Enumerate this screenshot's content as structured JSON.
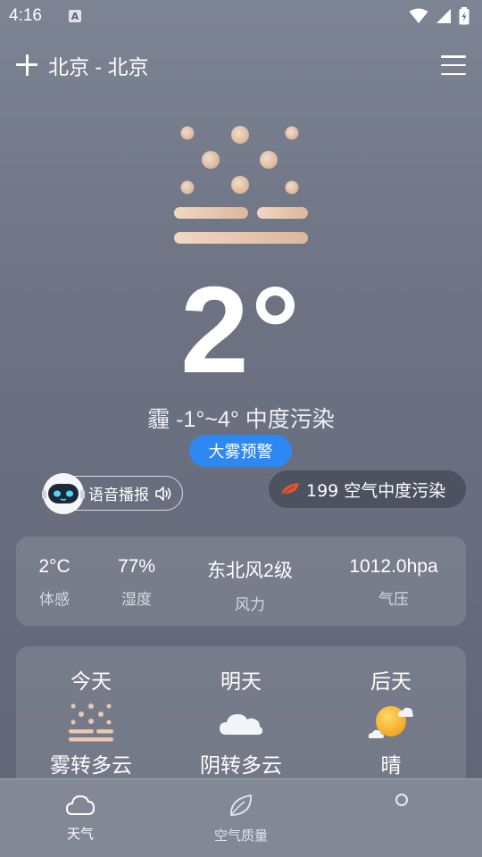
{
  "status_bar": {
    "time": "4:16",
    "notification_letter": "A",
    "icons": [
      "wifi-icon",
      "signal-icon",
      "battery-charging-icon"
    ]
  },
  "header": {
    "add_icon": "plus-icon",
    "city": "北京 - 北京",
    "menu_icon": "hamburger-menu-icon"
  },
  "current": {
    "weather_icon": "haze-icon",
    "temperature": "2°",
    "condition_line": "霾 -1°~4° 中度污染",
    "warning_label": "大雾预警",
    "voice_label": "语音播报",
    "voice_icon": "speaker-icon",
    "aqi_text": "199 空气中度污染",
    "aqi_icon": "leaf-icon"
  },
  "stats": [
    {
      "value": "2°C",
      "label": "体感"
    },
    {
      "value": "77%",
      "label": "湿度"
    },
    {
      "value": "东北风2级",
      "label": "风力"
    },
    {
      "value": "1012.0hpa",
      "label": "气压"
    }
  ],
  "forecast": [
    {
      "day": "今天",
      "condition": "雾转多云",
      "icon": "haze-icon"
    },
    {
      "day": "明天",
      "condition": "阴转多云",
      "icon": "cloud-icon"
    },
    {
      "day": "后天",
      "condition": "晴",
      "icon": "sun-cloud-icon"
    }
  ],
  "bottom_nav": {
    "items": [
      {
        "label": "天气",
        "icon": "cloud-icon",
        "active": true
      },
      {
        "label": "空气质量",
        "icon": "leaf-icon",
        "active": false
      }
    ],
    "extra_icon": "circle-icon"
  },
  "colors": {
    "accent_blue": "#2e88f1",
    "haze_bars": "#e8c8b0",
    "aqi_leaf": "#e8532a"
  }
}
